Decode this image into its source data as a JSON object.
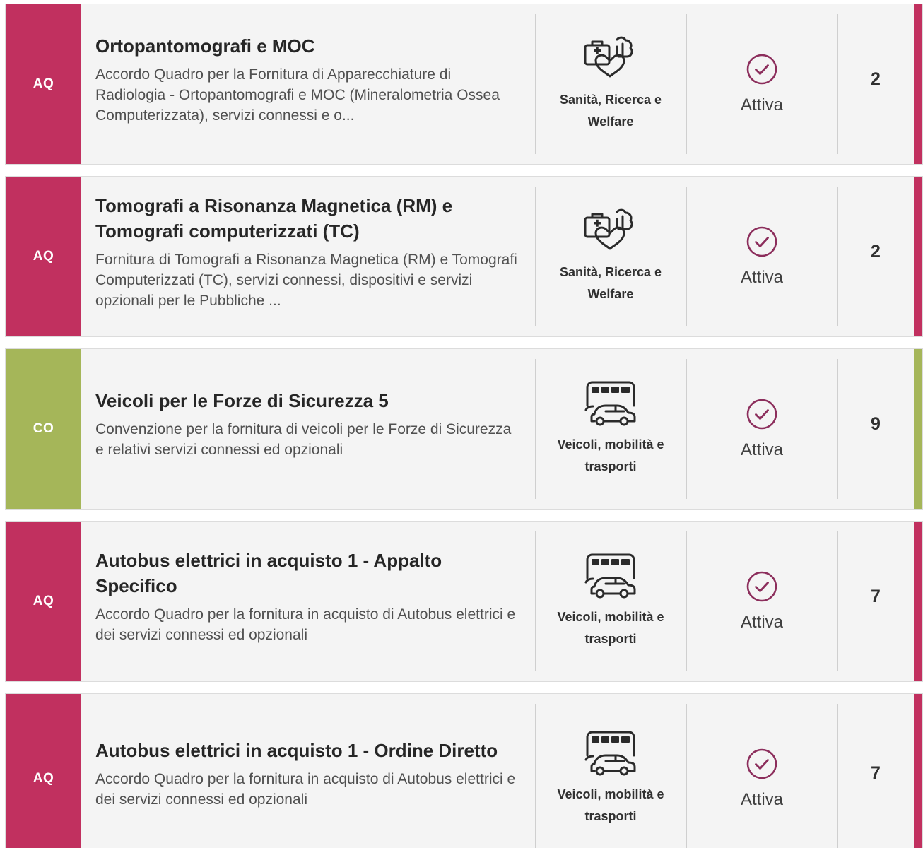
{
  "colors": {
    "aq": "#c1305f",
    "co": "#a5b659",
    "card_bg": "#f4f4f4",
    "check": "#8c2e5c"
  },
  "items": [
    {
      "tag": "AQ",
      "tag_color": "#c1305f",
      "title": "Ortopantomografi e MOC",
      "description": "Accordo Quadro per la Fornitura di Apparecchiature di Radiologia - Ortopantomografi e MOC (Mineralometria Ossea Computerizzata), servizi connessi e o...",
      "category": "Sanità, Ricerca e Welfare",
      "category_icon": "health-research-icon",
      "status": "Attiva",
      "count": "2"
    },
    {
      "tag": "AQ",
      "tag_color": "#c1305f",
      "title": "Tomografi a Risonanza Magnetica (RM) e Tomografi computerizzati (TC)",
      "description": "Fornitura di Tomografi a Risonanza Magnetica (RM) e Tomografi Computerizzati (TC), servizi connessi, dispositivi e servizi opzionali per le Pubbliche ...",
      "category": "Sanità, Ricerca e Welfare",
      "category_icon": "health-research-icon",
      "status": "Attiva",
      "count": "2"
    },
    {
      "tag": "CO",
      "tag_color": "#a5b659",
      "title": "Veicoli per le Forze di Sicurezza 5",
      "description": "Convenzione per la fornitura di veicoli per le Forze di Sicurezza e relativi servizi connessi ed opzionali",
      "category": "Veicoli, mobilità e trasporti",
      "category_icon": "vehicles-icon",
      "status": "Attiva",
      "count": "9"
    },
    {
      "tag": "AQ",
      "tag_color": "#c1305f",
      "title": "Autobus elettrici in acquisto 1 - Appalto Specifico",
      "description": "Accordo Quadro per la fornitura in acquisto di Autobus elettrici e dei servizi connessi ed opzionali",
      "category": "Veicoli, mobilità e trasporti",
      "category_icon": "vehicles-icon",
      "status": "Attiva",
      "count": "7"
    },
    {
      "tag": "AQ",
      "tag_color": "#c1305f",
      "title": "Autobus elettrici in acquisto 1 - Ordine Diretto",
      "description": "Accordo Quadro per la fornitura in acquisto di Autobus elettrici e dei servizi connessi ed opzionali",
      "category": "Veicoli, mobilità e trasporti",
      "category_icon": "vehicles-icon",
      "status": "Attiva",
      "count": "7"
    }
  ]
}
